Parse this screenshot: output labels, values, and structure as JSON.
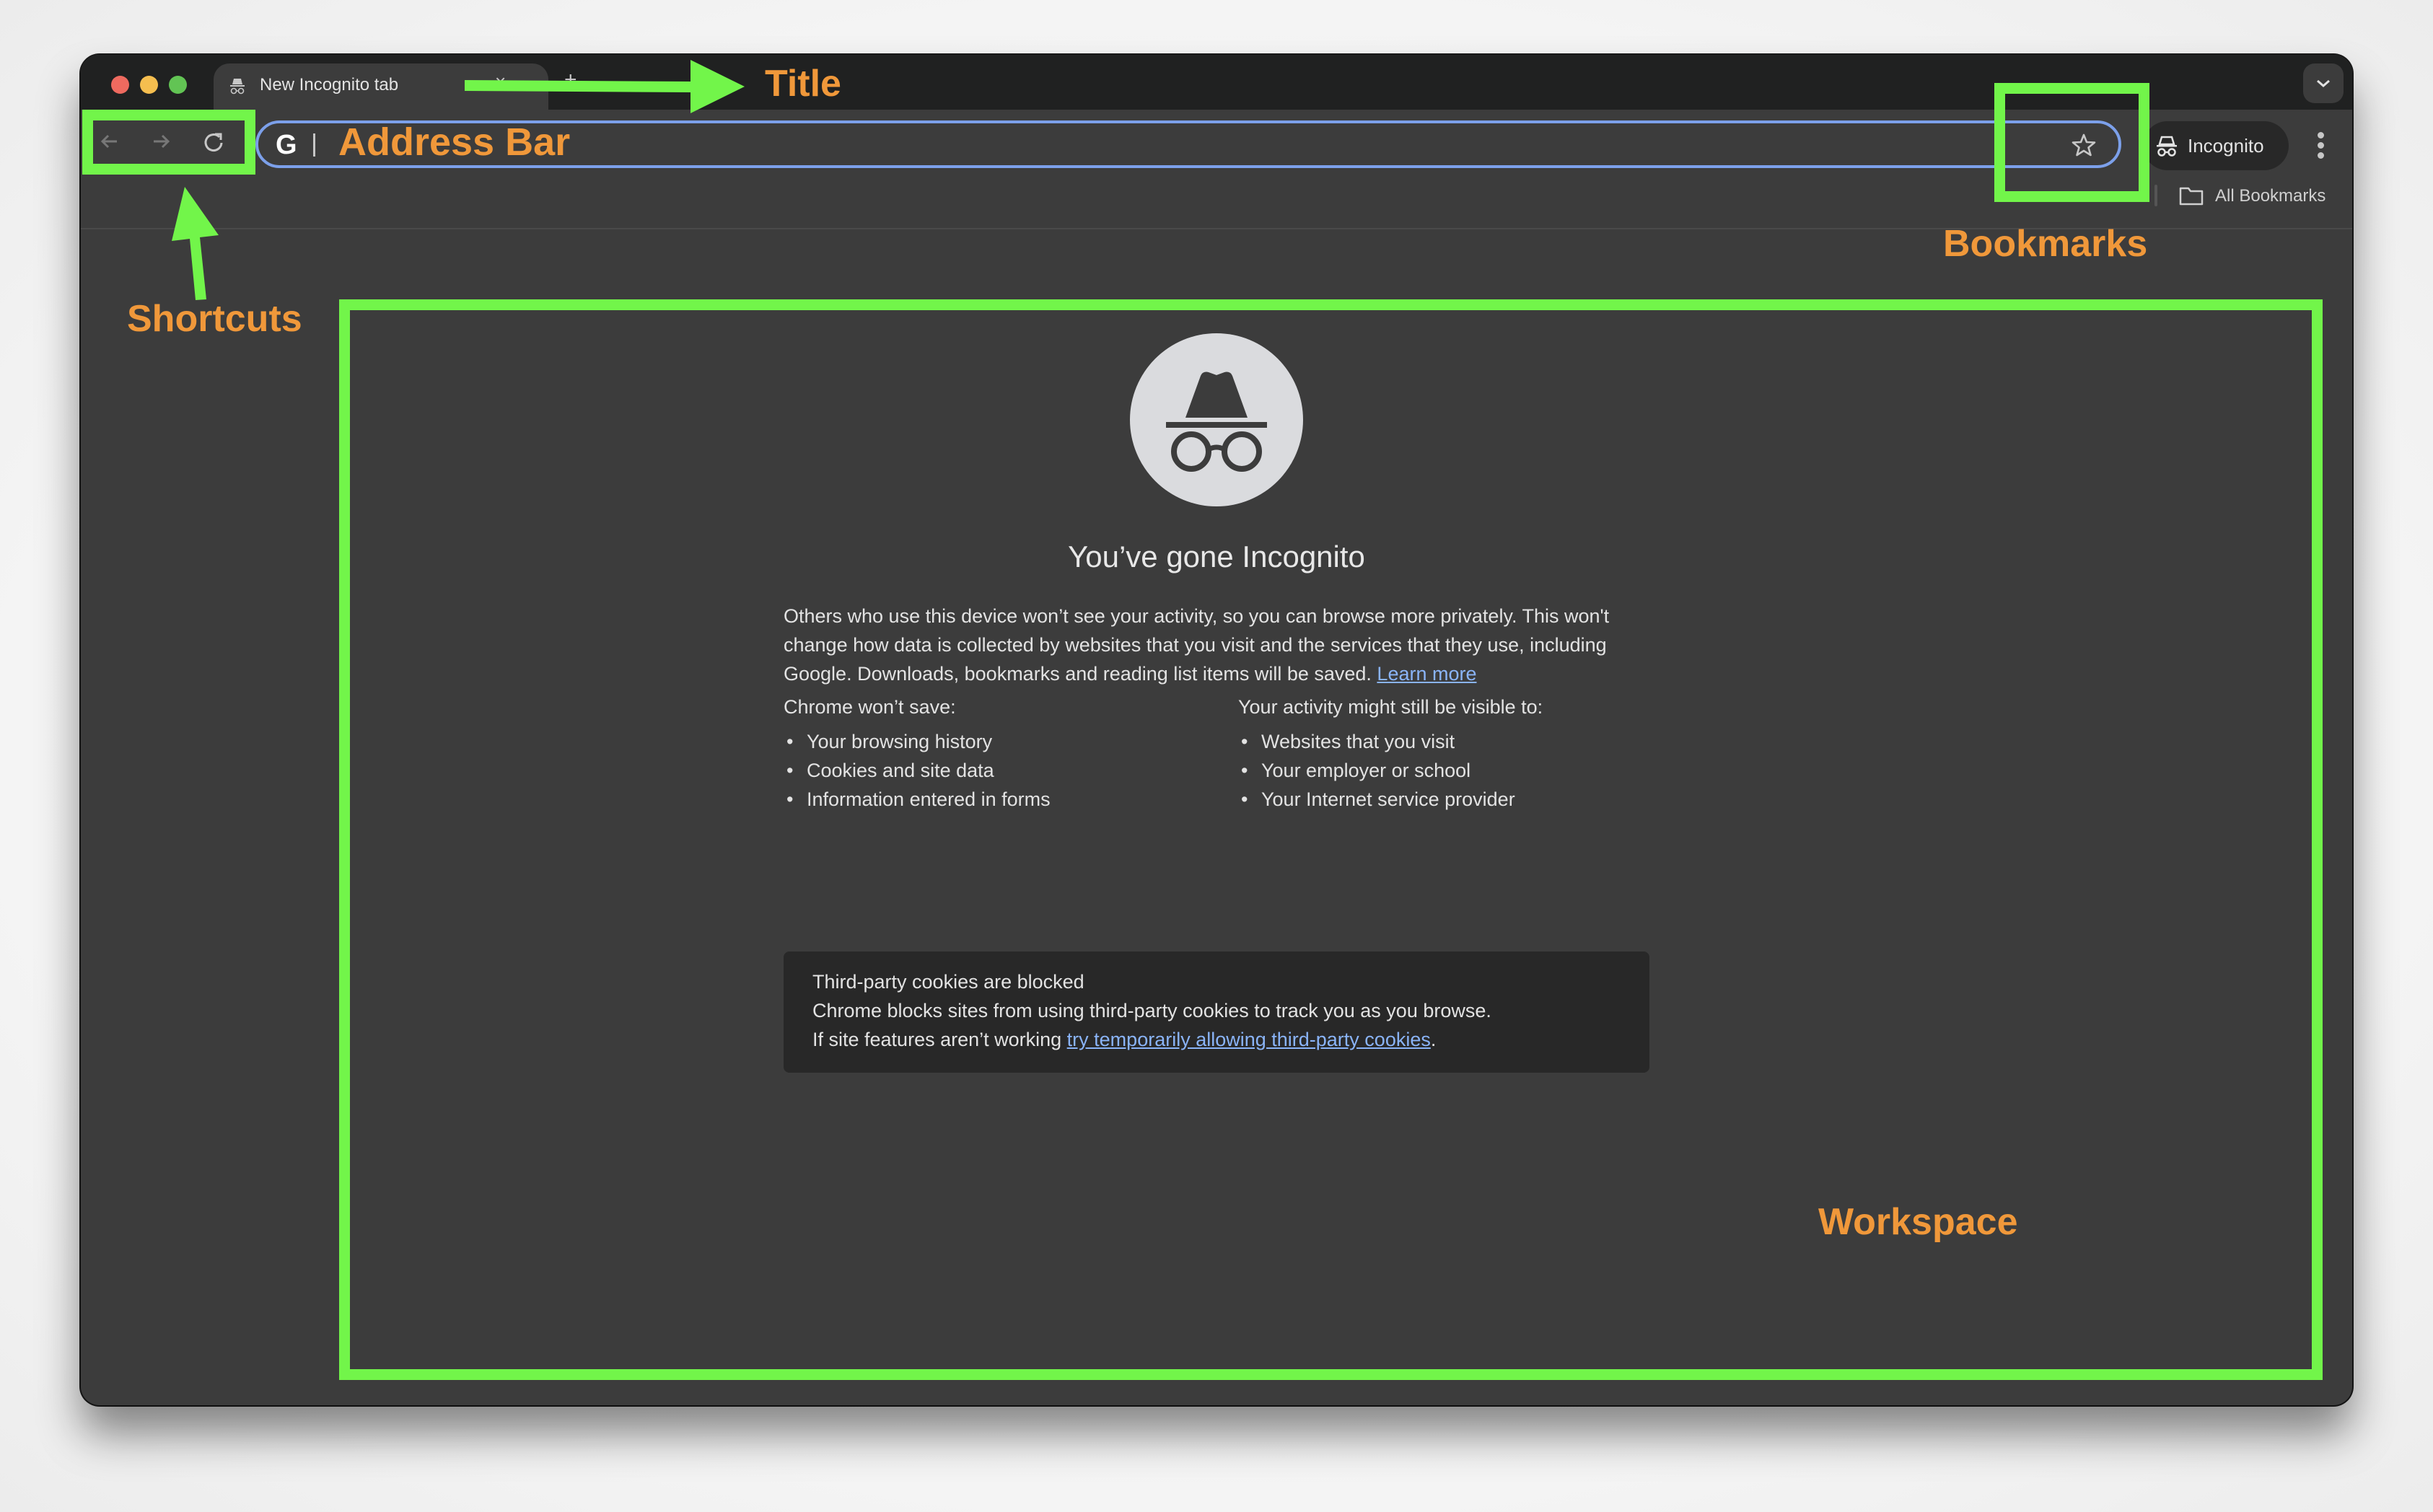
{
  "window": {
    "traffic_lights": [
      "close",
      "minimize",
      "zoom"
    ]
  },
  "tabs": [
    {
      "title": "New Incognito tab",
      "icon": "incognito-icon",
      "active": true
    }
  ],
  "tabstrip": {
    "close_glyph": "×",
    "new_tab_glyph": "+",
    "tab_search_icon": "chevron-down-icon"
  },
  "toolbar": {
    "back_icon": "arrow-left-icon",
    "forward_icon": "arrow-right-icon",
    "reload_icon": "reload-icon",
    "omnibox": {
      "search_engine_glyph": "G",
      "value": "",
      "bookmark_icon": "star-icon"
    },
    "profile_pill_label": "Incognito",
    "menu_icon": "kebab-menu-icon"
  },
  "bookmarks_bar": {
    "all_bookmarks_label": "All Bookmarks"
  },
  "page": {
    "headline": "You’ve gone Incognito",
    "intro": "Others who use this device won’t see your activity, so you can browse more privately. This won't change how data is collected by websites that you visit and the services that they use, including Google. Downloads, bookmarks and reading list items will be saved.",
    "learn_more": "Learn more",
    "wont_save_heading": "Chrome won’t save:",
    "wont_save_items": [
      "Your browsing history",
      "Cookies and site data",
      "Information entered in forms"
    ],
    "visible_heading": "Your activity might still be visible to:",
    "visible_items": [
      "Websites that you visit",
      "Your employer or school",
      "Your Internet service provider"
    ],
    "cookies_title": "Third-party cookies are blocked",
    "cookies_body": "Chrome blocks sites from using third-party cookies to track you as you browse.",
    "cookies_hint_prefix": "If site features aren’t working ",
    "cookies_hint_link": "try temporarily allowing third-party cookies",
    "cookies_hint_suffix": "."
  },
  "annotations": {
    "title": "Title",
    "address_bar": "Address Bar",
    "shortcuts": "Shortcuts",
    "bookmarks": "Bookmarks",
    "workspace": "Workspace",
    "box_color": "#72f54a",
    "label_color": "#f0983a"
  }
}
